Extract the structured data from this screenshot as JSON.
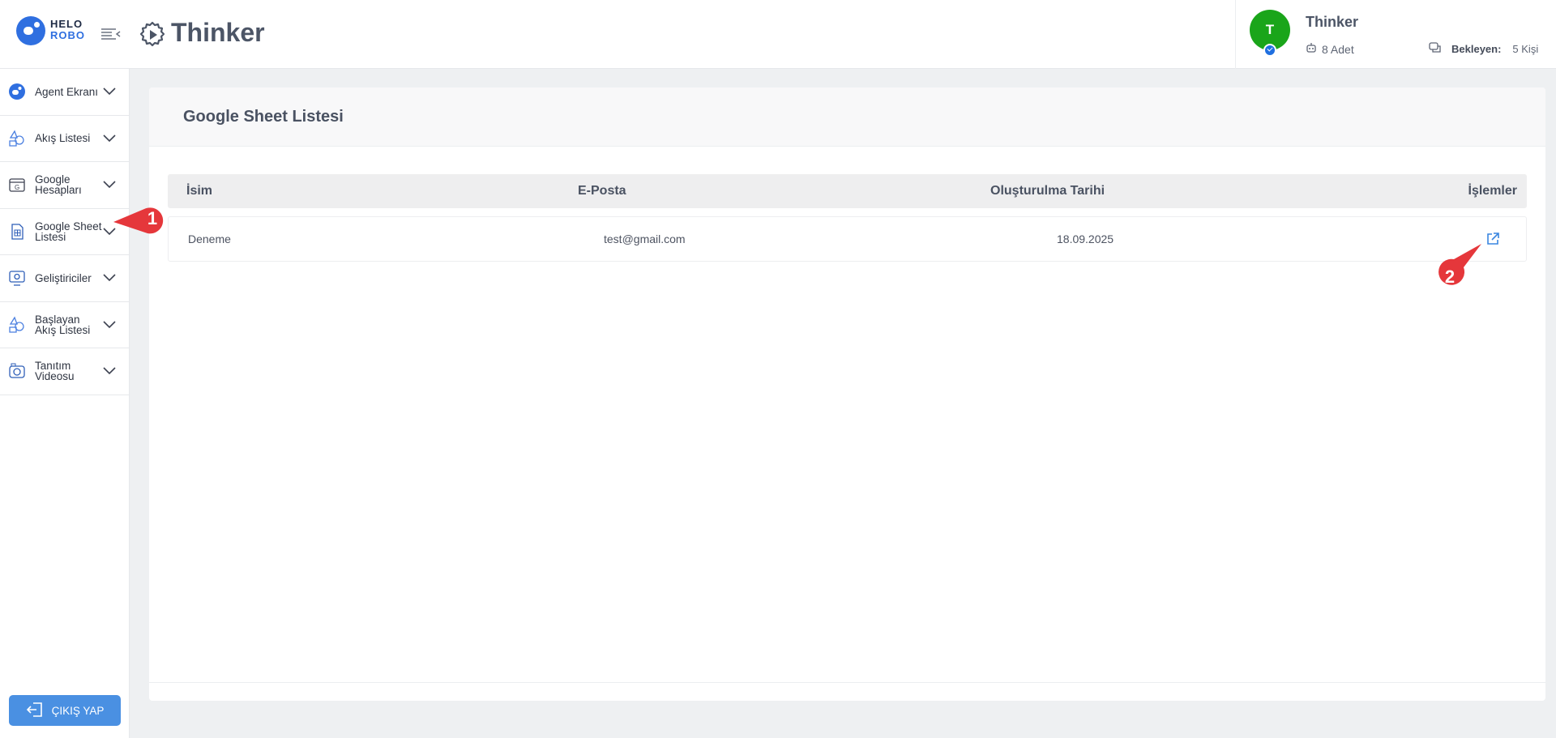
{
  "header": {
    "logo": {
      "line1": "HELO",
      "line2": "ROBO"
    },
    "brand_title": "Thinker",
    "menu_toggle_icon": "menu-collapse-icon",
    "brand_icon": "gear-play-icon"
  },
  "user": {
    "avatar_initial": "T",
    "name": "Thinker",
    "count_label": "8 Adet",
    "pending_label": "Bekleyen:",
    "pending_value": "5 Kişi"
  },
  "sidebar": {
    "items": [
      {
        "label": "Agent Ekranı",
        "icon": "robot-icon"
      },
      {
        "label": "Akış Listesi",
        "icon": "flow-icon"
      },
      {
        "label": "Google Hesapları",
        "icon": "google-account-icon"
      },
      {
        "label": "Google Sheet Listesi",
        "icon": "sheet-icon"
      },
      {
        "label": "Geliştiriciler",
        "icon": "developer-icon"
      },
      {
        "label": "Başlayan Akış Listesi",
        "icon": "flow-icon"
      },
      {
        "label": "Tanıtım Videosu",
        "icon": "video-icon"
      }
    ],
    "logout_label": "ÇIKIŞ YAP"
  },
  "main": {
    "title": "Google Sheet Listesi",
    "columns": [
      "İsim",
      "E-Posta",
      "Oluşturulma Tarihi",
      "İşlemler"
    ],
    "rows": [
      {
        "name": "Deneme",
        "email": "test@gmail.com",
        "created": "18.09.2025"
      }
    ]
  },
  "annotations": [
    "1",
    "2"
  ],
  "colors": {
    "accent": "#4a90e2",
    "avatar": "#1aa51a",
    "marker": "#e5373b"
  }
}
